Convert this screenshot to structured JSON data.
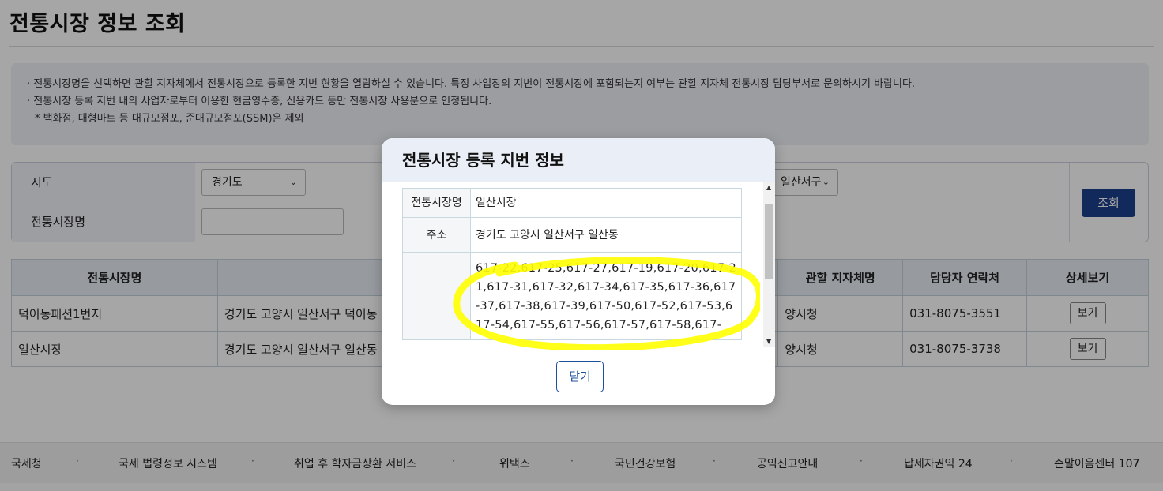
{
  "page": {
    "title": "전통시장 정보 조회",
    "notice": [
      "전통시장명을 선택하면 관할 지자체에서 전통시장으로 등록한 지번 현황을 열람하실 수 있습니다. 특정 사업장의 지번이 전통시장에 포함되는지 여부는 관할 지자체 전통시장 담당부서로 문의하시기 바랍니다.",
      "전통시장 등록 지번 내의 사업자로부터 이용한 현금영수증, 신용카드 등만 전통시장 사용분으로 인정됩니다.",
      "* 백화점, 대형마트 등 대규모점포, 준대규모점포(SSM)은 제외"
    ]
  },
  "search": {
    "sido_label": "시도",
    "sido_value": "경기도",
    "gu_value": "일산서구",
    "market_name_label": "전통시장명",
    "market_name_value": "",
    "submit_label": "조회"
  },
  "results": {
    "headers": [
      "전통시장명",
      "",
      "관할 지자체명",
      "담당자 연락처",
      "상세보기"
    ],
    "rows": [
      {
        "name": "덕이동패션1번지",
        "address": "경기도 고양시 일산서구 덕이동",
        "gov": "양시청",
        "phone": "031-8075-3551",
        "action": "보기"
      },
      {
        "name": "일산시장",
        "address": "경기도 고양시 일산서구 일산동",
        "gov": "양시청",
        "phone": "031-8075-3738",
        "action": "보기"
      }
    ]
  },
  "footer": {
    "links": [
      "국세청",
      "국세 법령정보 시스템",
      "취업 후 학자금상환 서비스",
      "위택스",
      "국민건강보험",
      "공익신고안내",
      "납세자권익 24",
      "손말이음센터 107"
    ]
  },
  "modal": {
    "title": "전통시장 등록 지번 정보",
    "rows": [
      {
        "label": "전통시장명",
        "value": "일산시장"
      },
      {
        "label": "주소",
        "value": "경기도 고양시 일산서구 일산동"
      },
      {
        "label": "",
        "value": "617-22,617-25,617-27,617-19,617-20,617-21,617-31,617-32,617-34,617-35,617-36,617-37,617-38,617-39,617-50,617-52,617-53,617-54,617-55,617-56,617-57,617-58,617-"
      }
    ],
    "close_label": "닫기"
  },
  "colors": {
    "accent": "#1d3f8c",
    "highlight": "#ffff00",
    "overlay": "rgba(0,0,0,0.35)"
  }
}
